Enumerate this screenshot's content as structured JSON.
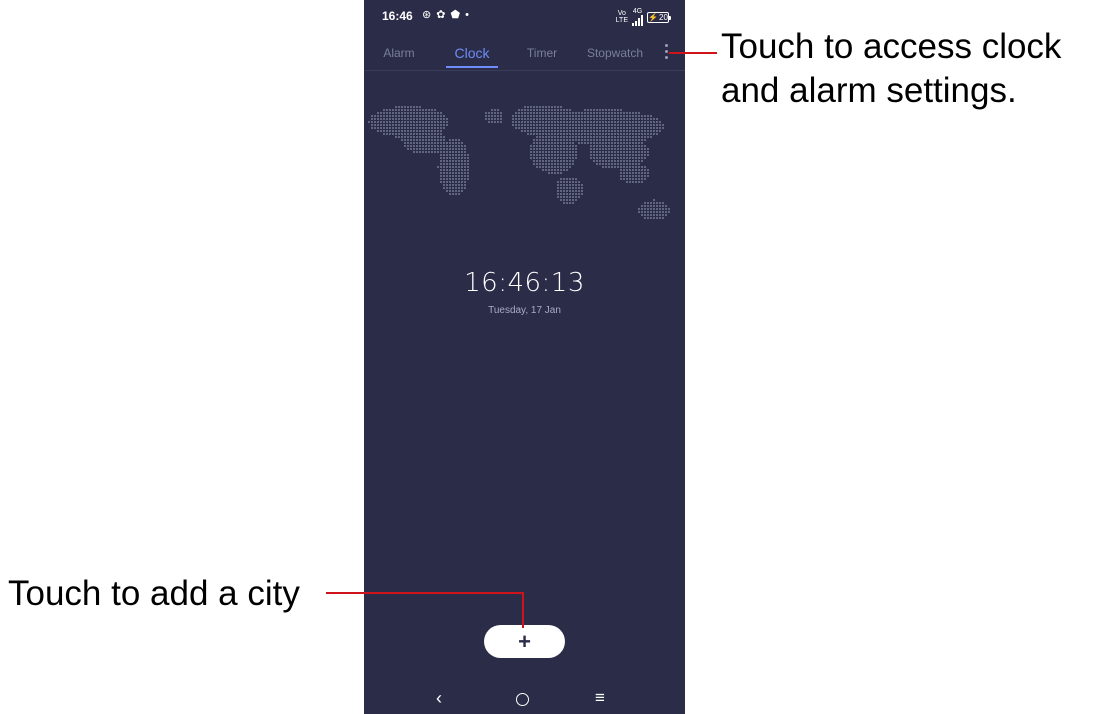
{
  "status_bar": {
    "time": "16:46",
    "left_icons": "⊛ ✿ ⬟ •",
    "network_label_top": "Vo",
    "network_label_bottom": "LTE",
    "network_gen": "4G",
    "battery_level": "20"
  },
  "tabs": [
    {
      "label": "Alarm",
      "active": false
    },
    {
      "label": "Clock",
      "active": true
    },
    {
      "label": "Timer",
      "active": false
    },
    {
      "label": "Stopwatch",
      "active": false
    }
  ],
  "clock": {
    "time": "16:46:13",
    "date": "Tuesday, 17 Jan"
  },
  "add_button_label": "+",
  "nav": {
    "back": "‹",
    "recent": "≡"
  },
  "annotations": {
    "settings_callout_line1": "Touch to access clock",
    "settings_callout_line2": "and alarm settings.",
    "add_city_callout": "Touch to add a city"
  },
  "colors": {
    "background": "#2b2d48",
    "accent": "#6d8cf5",
    "callout_line": "#d0121b"
  }
}
